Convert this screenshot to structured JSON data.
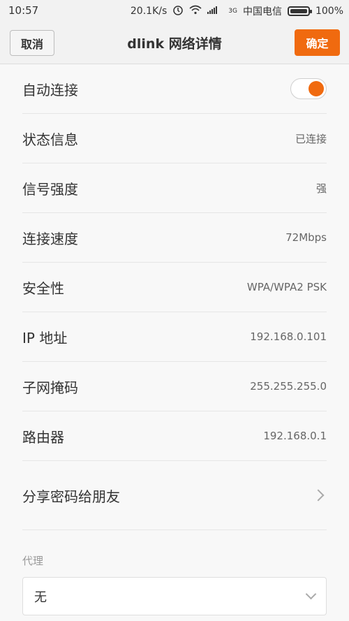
{
  "status_bar": {
    "time": "10:57",
    "speed": "20.1K/s",
    "signal_text": "3G",
    "carrier": "中国电信",
    "battery": "100%"
  },
  "header": {
    "cancel_label": "取消",
    "title": "dlink 网络详情",
    "ok_label": "确定"
  },
  "rows": [
    {
      "label": "自动连接",
      "toggle_on": true
    },
    {
      "label": "状态信息",
      "value": "已连接"
    },
    {
      "label": "信号强度",
      "value": "强"
    },
    {
      "label": "连接速度",
      "value": "72Mbps"
    },
    {
      "label": "安全性",
      "value": "WPA/WPA2 PSK"
    },
    {
      "label": "IP 地址",
      "value": "192.168.0.101"
    },
    {
      "label": "子网掩码",
      "value": "255.255.255.0"
    },
    {
      "label": "路由器",
      "value": "192.168.0.1"
    }
  ],
  "share": {
    "label": "分享密码给朋友"
  },
  "proxy": {
    "section_label": "代理",
    "value": "无"
  },
  "colors": {
    "accent": "#f06a0f"
  }
}
